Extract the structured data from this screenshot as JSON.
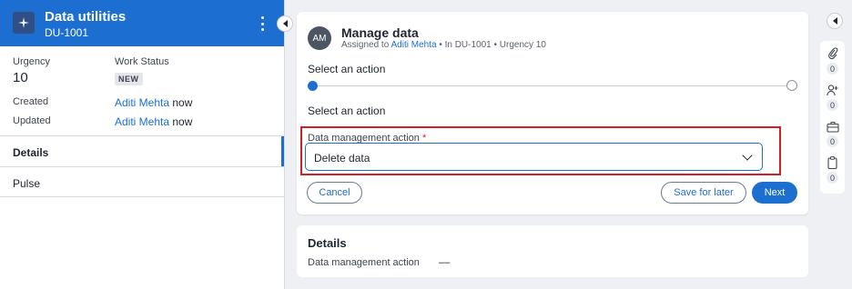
{
  "case": {
    "title": "Data utilities",
    "id": "DU-1001",
    "urgency_label": "Urgency",
    "urgency_value": "10",
    "status_label": "Work Status",
    "status_value": "NEW",
    "created_label": "Created",
    "created_by": "Aditi Mehta",
    "created_when": "now",
    "updated_label": "Updated",
    "updated_by": "Aditi Mehta",
    "updated_when": "now"
  },
  "nav": {
    "items": [
      {
        "label": "Details",
        "active": true
      },
      {
        "label": "Pulse",
        "active": false
      }
    ]
  },
  "task": {
    "avatar_initials": "AM",
    "title": "Manage data",
    "assigned_prefix": "Assigned to",
    "assignee": "Aditi Mehta",
    "context": "• In DU-1001 • Urgency 10",
    "step_title": "Select an action",
    "section_title": "Select an action",
    "field_label": "Data management action",
    "required_mark": "*",
    "field_value": "Delete data",
    "cancel_label": "Cancel",
    "save_label": "Save for later",
    "next_label": "Next"
  },
  "details": {
    "title": "Details",
    "field_label": "Data management action",
    "field_value": "––"
  },
  "rail": {
    "items": [
      {
        "icon": "paperclip-icon",
        "count": "0"
      },
      {
        "icon": "add-follower-icon",
        "count": "0"
      },
      {
        "icon": "briefcase-icon",
        "count": "0"
      },
      {
        "icon": "clipboard-icon",
        "count": "0"
      }
    ]
  },
  "colors": {
    "accent": "#1c6fd1",
    "highlight": "#d21f26"
  }
}
